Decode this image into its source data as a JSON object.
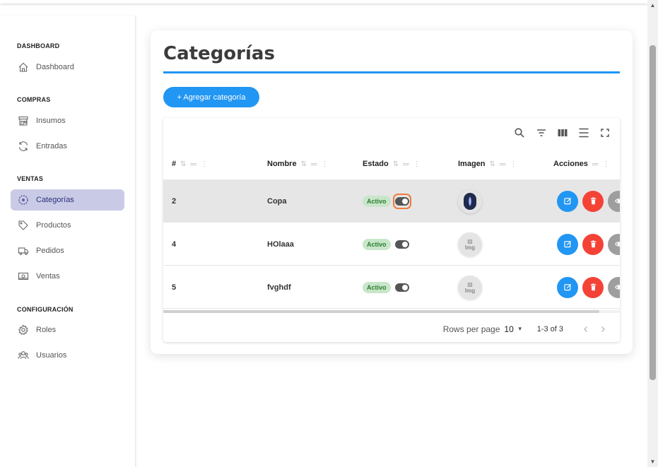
{
  "sidebar": {
    "sections": [
      {
        "title": "DASHBOARD",
        "items": [
          {
            "label": "Dashboard",
            "icon": "home-icon"
          }
        ]
      },
      {
        "title": "COMPRAS",
        "items": [
          {
            "label": "Insumos",
            "icon": "store-icon"
          },
          {
            "label": "Entradas",
            "icon": "refresh-icon"
          }
        ]
      },
      {
        "title": "VENTAS",
        "items": [
          {
            "label": "Categorías",
            "icon": "category-icon"
          },
          {
            "label": "Productos",
            "icon": "tag-icon"
          },
          {
            "label": "Pedidos",
            "icon": "truck-icon"
          },
          {
            "label": "Ventas",
            "icon": "cash-icon"
          }
        ]
      },
      {
        "title": "CONFIGURACIÓN",
        "items": [
          {
            "label": "Roles",
            "icon": "gear-icon"
          },
          {
            "label": "Usuarios",
            "icon": "users-icon"
          }
        ]
      }
    ],
    "active_item": "Categorías"
  },
  "main": {
    "title": "Categorías",
    "add_button_label": "+ Agregar categoría",
    "accent_color": "#2196f3"
  },
  "table": {
    "columns": [
      {
        "label": "#"
      },
      {
        "label": "Nombre"
      },
      {
        "label": "Estado"
      },
      {
        "label": "Imagen"
      },
      {
        "label": "Acciones"
      }
    ],
    "rows": [
      {
        "id": "2",
        "nombre": "Copa",
        "estado": "Activo",
        "imagen": "dark-logo",
        "selected": true
      },
      {
        "id": "4",
        "nombre": "HOlaaa",
        "estado": "Activo",
        "imagen": "broken-image"
      },
      {
        "id": "5",
        "nombre": "fvghdf",
        "estado": "Activo",
        "imagen": "broken-image"
      }
    ],
    "broken_image_alt": "Img",
    "footer": {
      "rows_per_page_label": "Rows per page",
      "rows_per_page_value": "10",
      "range_text": "1-3 of 3"
    }
  },
  "scroll": {
    "vertical_fraction_visible": 0.74,
    "horizontal_fraction_visible": 0.955
  }
}
